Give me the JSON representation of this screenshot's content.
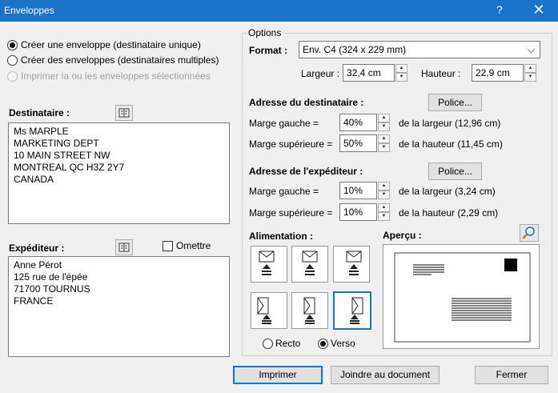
{
  "window": {
    "title": "Enveloppes",
    "help": "?",
    "close": "✕"
  },
  "mode": {
    "single_label": "Créer une enveloppe (destinataire unique)",
    "multiple_label": "Créer des enveloppes (destinataires multiples)",
    "selected_label": "Imprimer la ou les enveloppes sélectionnées"
  },
  "recipient": {
    "label": "Destinataire :",
    "address": "Ms MARPLE\nMARKETING DEPT\n10 MAIN STREET NW\nMONTREAL QC H3Z 2Y7\nCANADA"
  },
  "sender": {
    "label": "Expéditeur :",
    "omit_label": "Omettre",
    "address": "Anne Pérot\n125 rue de l'épée\n71700 TOURNUS\nFRANCE"
  },
  "options": {
    "legend": "Options",
    "format_label": "Format :",
    "format_value": "Env. C4 (324 x 229 mm)",
    "width_label": "Largeur :",
    "width_value": "32,4 cm",
    "height_label": "Hauteur :",
    "height_value": "22,9 cm"
  },
  "recipient_address": {
    "heading": "Adresse du destinataire :",
    "font_button": "Police...",
    "left_label": "Marge gauche =",
    "left_value": "40%",
    "left_note": "de la largeur (12,96 cm)",
    "top_label": "Marge supérieure =",
    "top_value": "50%",
    "top_note": "de la hauteur (11,45 cm)"
  },
  "sender_address": {
    "heading": "Adresse de l'expéditeur :",
    "font_button": "Police...",
    "left_label": "Marge gauche =",
    "left_value": "10%",
    "left_note": "de la largeur (3,24 cm)",
    "top_label": "Marge supérieure =",
    "top_value": "10%",
    "top_note": "de la hauteur (2,29 cm)"
  },
  "feed": {
    "heading": "Alimentation :",
    "recto_label": "Recto",
    "verso_label": "Verso",
    "selected_side": "Verso"
  },
  "preview": {
    "heading": "Aperçu :"
  },
  "buttons": {
    "print": "Imprimer",
    "attach": "Joindre au document",
    "close": "Fermer"
  },
  "colors": {
    "titlebar": "#1a73c9",
    "accent": "#0078d7"
  }
}
